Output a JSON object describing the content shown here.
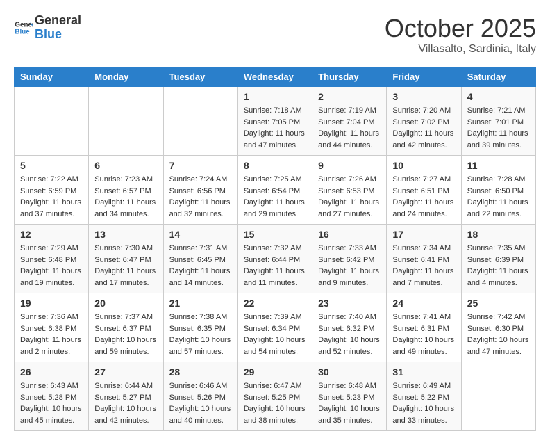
{
  "header": {
    "logo_line1": "General",
    "logo_line2": "Blue",
    "month": "October 2025",
    "location": "Villasalto, Sardinia, Italy"
  },
  "days_of_week": [
    "Sunday",
    "Monday",
    "Tuesday",
    "Wednesday",
    "Thursday",
    "Friday",
    "Saturday"
  ],
  "weeks": [
    [
      {
        "day": "",
        "info": ""
      },
      {
        "day": "",
        "info": ""
      },
      {
        "day": "",
        "info": ""
      },
      {
        "day": "1",
        "info": "Sunrise: 7:18 AM\nSunset: 7:05 PM\nDaylight: 11 hours\nand 47 minutes."
      },
      {
        "day": "2",
        "info": "Sunrise: 7:19 AM\nSunset: 7:04 PM\nDaylight: 11 hours\nand 44 minutes."
      },
      {
        "day": "3",
        "info": "Sunrise: 7:20 AM\nSunset: 7:02 PM\nDaylight: 11 hours\nand 42 minutes."
      },
      {
        "day": "4",
        "info": "Sunrise: 7:21 AM\nSunset: 7:01 PM\nDaylight: 11 hours\nand 39 minutes."
      }
    ],
    [
      {
        "day": "5",
        "info": "Sunrise: 7:22 AM\nSunset: 6:59 PM\nDaylight: 11 hours\nand 37 minutes."
      },
      {
        "day": "6",
        "info": "Sunrise: 7:23 AM\nSunset: 6:57 PM\nDaylight: 11 hours\nand 34 minutes."
      },
      {
        "day": "7",
        "info": "Sunrise: 7:24 AM\nSunset: 6:56 PM\nDaylight: 11 hours\nand 32 minutes."
      },
      {
        "day": "8",
        "info": "Sunrise: 7:25 AM\nSunset: 6:54 PM\nDaylight: 11 hours\nand 29 minutes."
      },
      {
        "day": "9",
        "info": "Sunrise: 7:26 AM\nSunset: 6:53 PM\nDaylight: 11 hours\nand 27 minutes."
      },
      {
        "day": "10",
        "info": "Sunrise: 7:27 AM\nSunset: 6:51 PM\nDaylight: 11 hours\nand 24 minutes."
      },
      {
        "day": "11",
        "info": "Sunrise: 7:28 AM\nSunset: 6:50 PM\nDaylight: 11 hours\nand 22 minutes."
      }
    ],
    [
      {
        "day": "12",
        "info": "Sunrise: 7:29 AM\nSunset: 6:48 PM\nDaylight: 11 hours\nand 19 minutes."
      },
      {
        "day": "13",
        "info": "Sunrise: 7:30 AM\nSunset: 6:47 PM\nDaylight: 11 hours\nand 17 minutes."
      },
      {
        "day": "14",
        "info": "Sunrise: 7:31 AM\nSunset: 6:45 PM\nDaylight: 11 hours\nand 14 minutes."
      },
      {
        "day": "15",
        "info": "Sunrise: 7:32 AM\nSunset: 6:44 PM\nDaylight: 11 hours\nand 11 minutes."
      },
      {
        "day": "16",
        "info": "Sunrise: 7:33 AM\nSunset: 6:42 PM\nDaylight: 11 hours\nand 9 minutes."
      },
      {
        "day": "17",
        "info": "Sunrise: 7:34 AM\nSunset: 6:41 PM\nDaylight: 11 hours\nand 7 minutes."
      },
      {
        "day": "18",
        "info": "Sunrise: 7:35 AM\nSunset: 6:39 PM\nDaylight: 11 hours\nand 4 minutes."
      }
    ],
    [
      {
        "day": "19",
        "info": "Sunrise: 7:36 AM\nSunset: 6:38 PM\nDaylight: 11 hours\nand 2 minutes."
      },
      {
        "day": "20",
        "info": "Sunrise: 7:37 AM\nSunset: 6:37 PM\nDaylight: 10 hours\nand 59 minutes."
      },
      {
        "day": "21",
        "info": "Sunrise: 7:38 AM\nSunset: 6:35 PM\nDaylight: 10 hours\nand 57 minutes."
      },
      {
        "day": "22",
        "info": "Sunrise: 7:39 AM\nSunset: 6:34 PM\nDaylight: 10 hours\nand 54 minutes."
      },
      {
        "day": "23",
        "info": "Sunrise: 7:40 AM\nSunset: 6:32 PM\nDaylight: 10 hours\nand 52 minutes."
      },
      {
        "day": "24",
        "info": "Sunrise: 7:41 AM\nSunset: 6:31 PM\nDaylight: 10 hours\nand 49 minutes."
      },
      {
        "day": "25",
        "info": "Sunrise: 7:42 AM\nSunset: 6:30 PM\nDaylight: 10 hours\nand 47 minutes."
      }
    ],
    [
      {
        "day": "26",
        "info": "Sunrise: 6:43 AM\nSunset: 5:28 PM\nDaylight: 10 hours\nand 45 minutes."
      },
      {
        "day": "27",
        "info": "Sunrise: 6:44 AM\nSunset: 5:27 PM\nDaylight: 10 hours\nand 42 minutes."
      },
      {
        "day": "28",
        "info": "Sunrise: 6:46 AM\nSunset: 5:26 PM\nDaylight: 10 hours\nand 40 minutes."
      },
      {
        "day": "29",
        "info": "Sunrise: 6:47 AM\nSunset: 5:25 PM\nDaylight: 10 hours\nand 38 minutes."
      },
      {
        "day": "30",
        "info": "Sunrise: 6:48 AM\nSunset: 5:23 PM\nDaylight: 10 hours\nand 35 minutes."
      },
      {
        "day": "31",
        "info": "Sunrise: 6:49 AM\nSunset: 5:22 PM\nDaylight: 10 hours\nand 33 minutes."
      },
      {
        "day": "",
        "info": ""
      }
    ]
  ]
}
